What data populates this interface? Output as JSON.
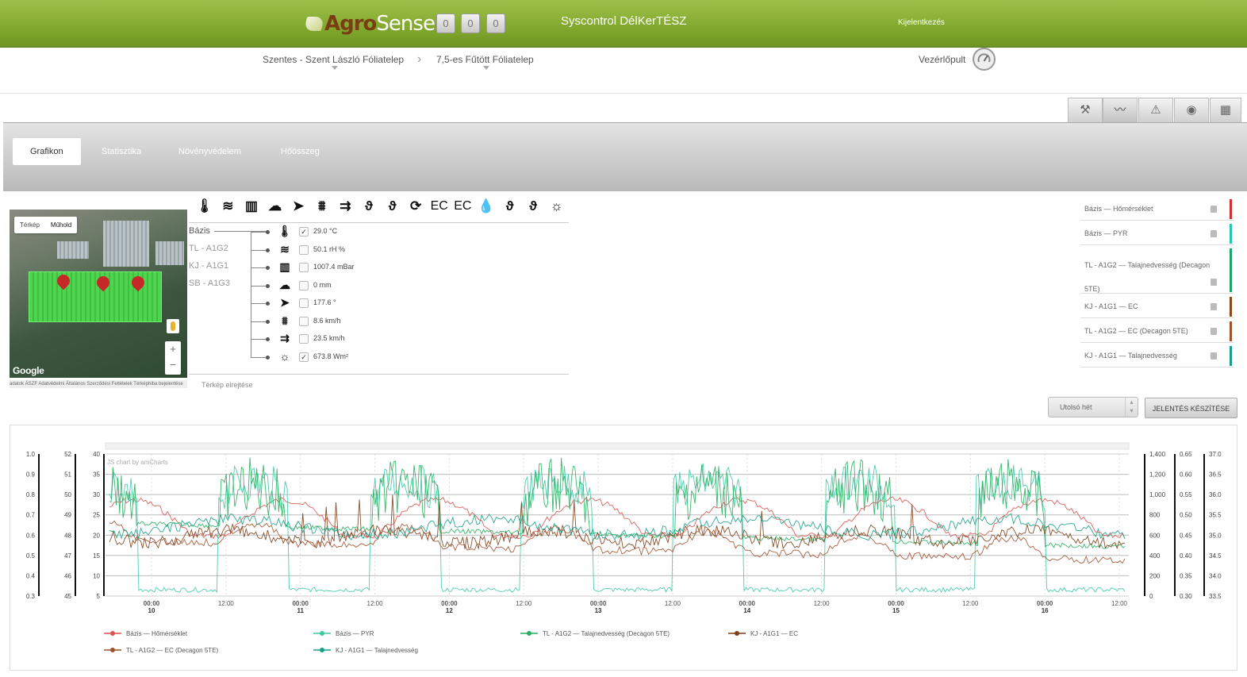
{
  "header": {
    "logo_a": "Agro",
    "logo_b": "Sense",
    "counters": [
      "0",
      "0",
      "0"
    ],
    "site_title": "Syscontrol DélKerTÉSZ",
    "logout": "Kijelentkezés"
  },
  "breadcrumb": {
    "items": [
      "Szentes - Szent László Fóliatelep",
      "7,5-es Fűtött Fóliatelep"
    ],
    "dashboard_label": "Vezérlőpult"
  },
  "toolbar": {
    "icons": [
      "wrench-icon",
      "graph-icon",
      "alert-icon",
      "target-icon",
      "grid-icon"
    ],
    "active": 1
  },
  "tabs": {
    "items": [
      "Grafikon",
      "Statisztika",
      "Növényvédelem",
      "Hőösszeg"
    ],
    "active": 0
  },
  "map": {
    "map_btn": "Térkép",
    "sat_btn": "Műhold",
    "zoom_in": "+",
    "zoom_out": "−",
    "google": "Google",
    "footer": "adatok ÁSZF Adatvédelmi Általános Szerződési Feltételek Térképhiba bejelentése",
    "hide_link": "Térkép elrejtése"
  },
  "sensor_icons": {
    "icons": [
      "thermometer-icon",
      "humidity-waves-icon",
      "pressure-icon",
      "rain-cloud-icon",
      "wind-direction-icon",
      "wind-gust-icon",
      "wind-speed-icon",
      "soil-temp-icon",
      "soil-moisture-icon",
      "leaf-wetness-icon",
      "ec-icon",
      "ec2-icon",
      "drop-ec-icon",
      "soil-temp2-icon",
      "soil-moisture2-icon",
      "sun-icon"
    ],
    "labels": [
      "🌡",
      "≋",
      "▥",
      "☁",
      "➤",
      "⩩",
      "⇉",
      "ϑ",
      "ϑ",
      "⟳",
      "EC",
      "EC",
      "💧",
      "ϑ",
      "ϑ",
      "☼"
    ]
  },
  "stations": [
    "Bázis",
    "TL - A1G2",
    "KJ - A1G1",
    "SB - A1G3"
  ],
  "measurements": [
    {
      "icon": "thermometer-icon",
      "glyph": "🌡",
      "checked": true,
      "value": "29.0 °C"
    },
    {
      "icon": "humidity-icon",
      "glyph": "≋",
      "checked": false,
      "value": "50.1 rH %"
    },
    {
      "icon": "pressure-icon",
      "glyph": "▥",
      "checked": false,
      "value": "1007.4 mBar"
    },
    {
      "icon": "rain-icon",
      "glyph": "☁",
      "checked": false,
      "value": "0 mm"
    },
    {
      "icon": "wind-direction-icon",
      "glyph": "➤",
      "checked": false,
      "value": "177.6 °"
    },
    {
      "icon": "wind-gust-icon",
      "glyph": "⩩",
      "checked": false,
      "value": "8.6 km/h"
    },
    {
      "icon": "wind-speed-icon",
      "glyph": "⇉",
      "checked": false,
      "value": "23.5 km/h"
    },
    {
      "icon": "sun-icon",
      "glyph": "☼",
      "checked": true,
      "value": "673.8 Wm²"
    }
  ],
  "selected": [
    {
      "label": "Bázis — Hőmérséklet",
      "color": "#d32f2f"
    },
    {
      "label": "Bázis — PYR",
      "color": "#26c6b0"
    },
    {
      "label": "TL - A1G2 — Talajnedvesség (Decagon 5TE)",
      "color": "#1aa36a"
    },
    {
      "label": "KJ - A1G1 — EC",
      "color": "#8a4a1a"
    },
    {
      "label": "TL - A1G2 — EC (Decagon 5TE)",
      "color": "#a0522d"
    },
    {
      "label": "KJ - A1G1 — Talajnedvesség",
      "color": "#16a085"
    }
  ],
  "period": {
    "value": "Utolsó hét"
  },
  "report_button": "JELENTÉS KÉSZÍTÉSE",
  "chart_data": {
    "type": "line",
    "credit": "JS chart by amCharts",
    "x_ticks": [
      {
        "main": "00:00",
        "sub": "10"
      },
      {
        "main": "12:00",
        "sub": ""
      },
      {
        "main": "00:00",
        "sub": "11"
      },
      {
        "main": "12:00",
        "sub": ""
      },
      {
        "main": "00:00",
        "sub": "12"
      },
      {
        "main": "12:00",
        "sub": ""
      },
      {
        "main": "00:00",
        "sub": "13"
      },
      {
        "main": "12:00",
        "sub": ""
      },
      {
        "main": "00:00",
        "sub": "14"
      },
      {
        "main": "12:00",
        "sub": ""
      },
      {
        "main": "00:00",
        "sub": "15"
      },
      {
        "main": "12:00",
        "sub": ""
      },
      {
        "main": "00:00",
        "sub": "16"
      },
      {
        "main": "12:00",
        "sub": ""
      }
    ],
    "left_axes": [
      {
        "labels": [
          "1.0",
          "0.9",
          "0.8",
          "0.7",
          "0.6",
          "0.5",
          "0.4",
          "0.3"
        ]
      },
      {
        "labels": [
          "52",
          "51",
          "50",
          "49",
          "48",
          "47",
          "46",
          "45"
        ]
      },
      {
        "labels": [
          "40",
          "35",
          "30",
          "25",
          "20",
          "15",
          "10",
          "5"
        ]
      }
    ],
    "right_axes": [
      {
        "labels": [
          "1,400",
          "1,200",
          "1,000",
          "800",
          "600",
          "400",
          "200",
          "0"
        ]
      },
      {
        "labels": [
          "0.65",
          "0.60",
          "0.55",
          "0.50",
          "0.45",
          "0.40",
          "0.35",
          "0.30"
        ]
      },
      {
        "labels": [
          "37.0",
          "36.5",
          "36.0",
          "35.5",
          "35.0",
          "34.5",
          "34.0",
          "33.5"
        ]
      }
    ],
    "series": [
      {
        "name": "Bázis — Hőmérséklet",
        "color": "#d9534f",
        "axis": "Bázis — Hőmérséklet"
      },
      {
        "name": "Bázis — PYR",
        "color": "#3cc9a6",
        "axis": "Bázis — PYR"
      },
      {
        "name": "TL - A1G2 — Talajnedvesség (Decagon 5TE)",
        "color": "#27ae60",
        "axis": ""
      },
      {
        "name": "KJ - A1G1 — EC",
        "color": "#7b3f17",
        "axis": ""
      },
      {
        "name": "TL - A1G2 — EC (Decagon 5TE)",
        "color": "#a0522d",
        "axis": ""
      },
      {
        "name": "KJ - A1G1 — Talajnedvesség",
        "color": "#16a085",
        "axis": ""
      }
    ]
  }
}
